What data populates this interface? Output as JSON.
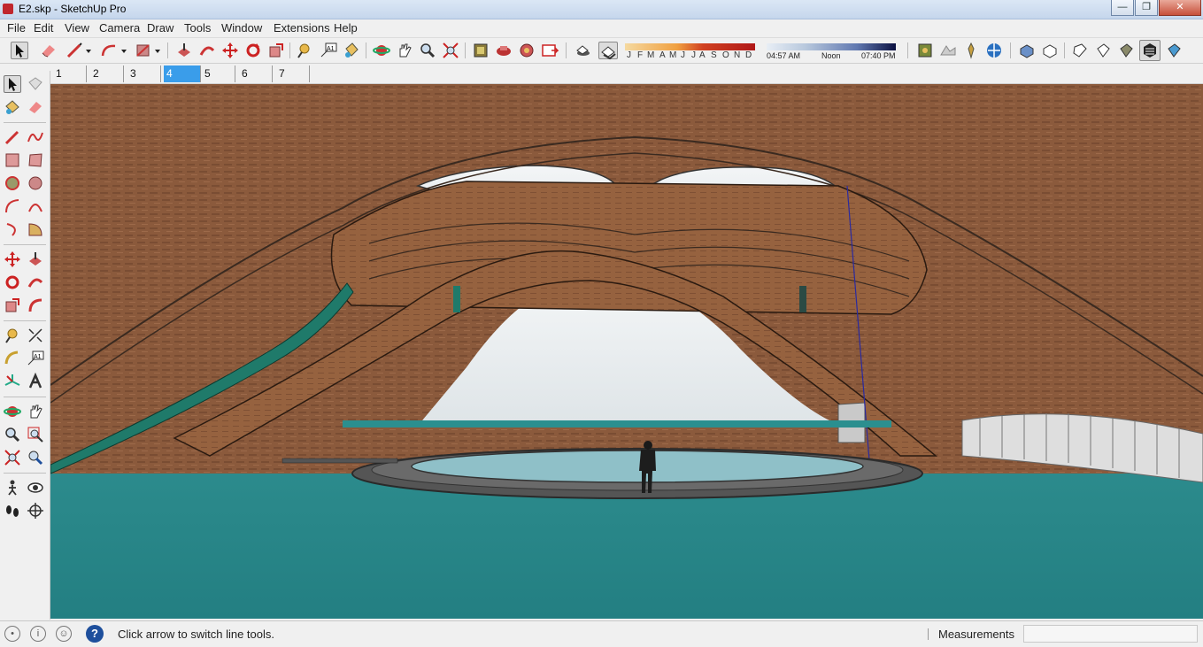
{
  "window": {
    "title": "E2.skp - SketchUp Pro"
  },
  "menu": [
    "File",
    "Edit",
    "View",
    "Camera",
    "Draw",
    "Tools",
    "Window",
    "Extensions",
    "Help"
  ],
  "shadow": {
    "months": [
      "J",
      "F",
      "M",
      "A",
      "M",
      "J",
      "J",
      "A",
      "S",
      "O",
      "N",
      "D"
    ],
    "time_start": "04:57 AM",
    "time_mid": "Noon",
    "time_end": "07:40 PM"
  },
  "scene_tabs": [
    "1",
    "2",
    "3",
    "4",
    "5",
    "6",
    "7"
  ],
  "active_scene": "4",
  "status": {
    "hint": "Click arrow to switch line tools.",
    "measurements_label": "Measurements",
    "measurements_value": ""
  },
  "colors": {
    "wood": "#8b5a3c",
    "water": "#2a8a8a",
    "sky": "#e8ecef",
    "accent_green": "#1f7a6a",
    "scene_tab_active": "#3a9dea"
  }
}
